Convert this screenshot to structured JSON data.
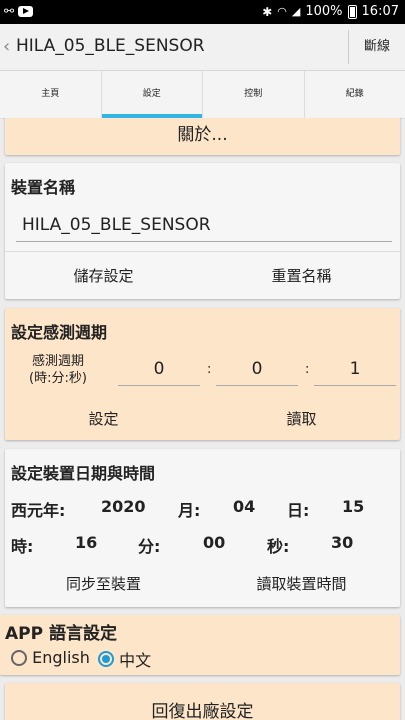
{
  "status_bar": {
    "time": "16:07",
    "battery": "100%",
    "icons": [
      "link-icon",
      "youtube-icon",
      "bluetooth-icon",
      "wifi-icon",
      "signal-icon",
      "battery-icon"
    ]
  },
  "app_bar": {
    "title": "HILA_05_BLE_SENSOR",
    "disconnect_label": "斷線"
  },
  "tabs": [
    {
      "label": "主頁",
      "active": false
    },
    {
      "label": "設定",
      "active": true
    },
    {
      "label": "控制",
      "active": false
    },
    {
      "label": "紀錄",
      "active": false
    }
  ],
  "about": {
    "label": "關於..."
  },
  "device_name": {
    "title": "裝置名稱",
    "value": "HILA_05_BLE_SENSOR",
    "save_label": "儲存設定",
    "reset_label": "重置名稱"
  },
  "sensing_period": {
    "title": "設定感測週期",
    "field_label_line1": "感測週期",
    "field_label_line2": "(時:分:秒)",
    "hours": "0",
    "minutes": "0",
    "seconds": "1",
    "separator": ":",
    "set_label": "設定",
    "read_label": "讀取"
  },
  "datetime": {
    "title": "設定裝置日期與時間",
    "year_label": "西元年:",
    "year": "2020",
    "month_label": "月:",
    "month": "04",
    "day_label": "日:",
    "day": "15",
    "hour_label": "時:",
    "hour": "16",
    "minute_label": "分:",
    "minute": "00",
    "second_label": "秒:",
    "second": "30",
    "sync_label": "同步至裝置",
    "read_label": "讀取裝置時間"
  },
  "language": {
    "title": "APP 語言設定",
    "options": [
      {
        "label": "English",
        "selected": false
      },
      {
        "label": "中文",
        "selected": true
      }
    ]
  },
  "factory_reset": {
    "label": "回復出廠設定"
  },
  "colors": {
    "accent": "#33b5e5",
    "card_orange": "#fde5c9",
    "radio_selected": "#1e9ad6"
  }
}
